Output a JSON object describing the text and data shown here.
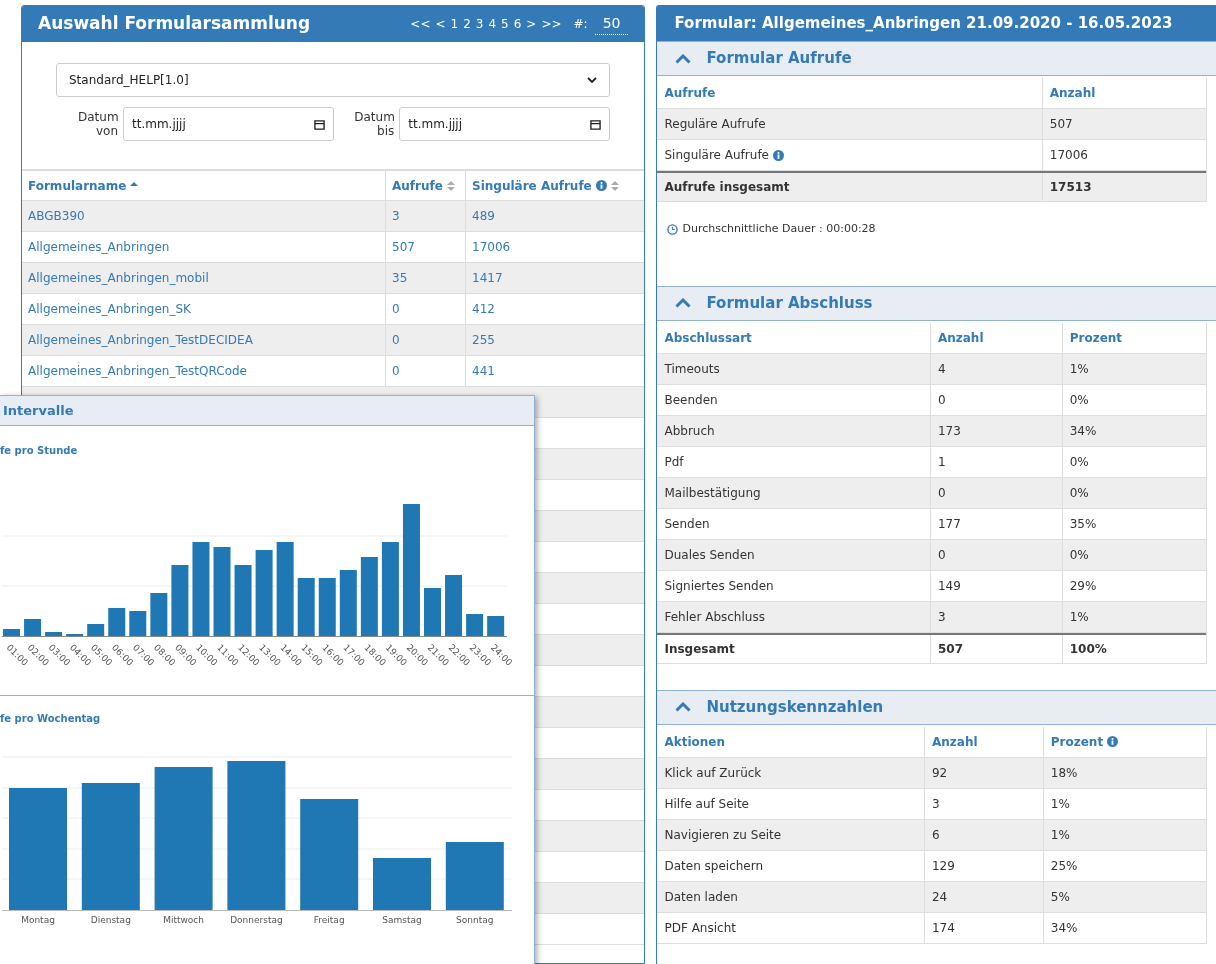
{
  "left_panel": {
    "title": "Auswahl Formularsammlung",
    "pagination": [
      "<<",
      "<",
      "1",
      "2",
      "3",
      "4",
      "5",
      "6",
      ">",
      ">>"
    ],
    "page_size_label": "#:",
    "page_size": "50",
    "collection_select": "Standard_HELP[1.0]",
    "date_fields": [
      {
        "label": "Datum von",
        "placeholder": "tt.mm.jjjj"
      },
      {
        "label": "Datum bis",
        "placeholder": "tt.mm.jjjj"
      }
    ],
    "table": {
      "columns": [
        {
          "label": "Formularname",
          "sorted": true,
          "info": false
        },
        {
          "label": "Aufrufe",
          "sorted": false,
          "info": false
        },
        {
          "label": "Singuläre Aufrufe",
          "sorted": false,
          "info": true
        }
      ],
      "rows": [
        [
          "ABGB390",
          "3",
          "489"
        ],
        [
          "Allgemeines_Anbringen",
          "507",
          "17006"
        ],
        [
          "Allgemeines_Anbringen_mobil",
          "35",
          "1417"
        ],
        [
          "Allgemeines_Anbringen_SK",
          "0",
          "412"
        ],
        [
          "Allgemeines_Anbringen_TestDECIDEA",
          "0",
          "255"
        ],
        [
          "Allgemeines_Anbringen_TestQRCode",
          "0",
          "441"
        ]
      ]
    }
  },
  "interval_popup": {
    "title": "Intervalle",
    "hourly": {
      "title": "fe pro Stunde",
      "labels": [
        "01:00",
        "02:00",
        "03:00",
        "04:00",
        "05:00",
        "06:00",
        "07:00",
        "08:00",
        "09:00",
        "10:00",
        "11:00",
        "12:00",
        "13:00",
        "14:00",
        "15:00",
        "16:00",
        "17:00",
        "18:00",
        "19:00",
        "20:00",
        "21:00",
        "22:00",
        "23:00",
        "24:00"
      ]
    },
    "weekly": {
      "title": "fe pro Wochentag",
      "labels": [
        "Montag",
        "Dienstag",
        "Mittwoch",
        "Donnerstag",
        "Freitag",
        "Samstag",
        "Sonntag"
      ]
    }
  },
  "detail_panel": {
    "title": "Formular: Allgemeines_Anbringen 21.09.2020 - 16.05.2023",
    "sections": [
      {
        "title": "Formular Aufrufe",
        "expanded": true,
        "columns": [
          {
            "label": "Aufrufe",
            "info": false
          },
          {
            "label": "Anzahl",
            "info": false
          }
        ],
        "rows": [
          {
            "cells": [
              "Reguläre Aufrufe",
              "507"
            ],
            "info": false,
            "total": false
          },
          {
            "cells": [
              "Singuläre Aufrufe",
              "17006"
            ],
            "info": true,
            "total": false
          },
          {
            "cells": [
              "Aufrufe insgesamt",
              "17513"
            ],
            "info": false,
            "total": true
          }
        ],
        "note": "Durchschnittliche Dauer : 00:00:28"
      },
      {
        "title": "Formular Abschluss",
        "expanded": true,
        "columns": [
          {
            "label": "Abschlussart",
            "info": false
          },
          {
            "label": "Anzahl",
            "info": false
          },
          {
            "label": "Prozent",
            "info": false
          }
        ],
        "rows": [
          {
            "cells": [
              "Timeouts",
              "4",
              "1%"
            ],
            "info": false,
            "total": false
          },
          {
            "cells": [
              "Beenden",
              "0",
              "0%"
            ],
            "info": false,
            "total": false
          },
          {
            "cells": [
              "Abbruch",
              "173",
              "34%"
            ],
            "info": false,
            "total": false
          },
          {
            "cells": [
              "Pdf",
              "1",
              "0%"
            ],
            "info": false,
            "total": false
          },
          {
            "cells": [
              "Mailbestätigung",
              "0",
              "0%"
            ],
            "info": false,
            "total": false
          },
          {
            "cells": [
              "Senden",
              "177",
              "35%"
            ],
            "info": false,
            "total": false
          },
          {
            "cells": [
              "Duales Senden",
              "0",
              "0%"
            ],
            "info": false,
            "total": false
          },
          {
            "cells": [
              "Signiertes Senden",
              "149",
              "29%"
            ],
            "info": false,
            "total": false
          },
          {
            "cells": [
              "Fehler Abschluss",
              "3",
              "1%"
            ],
            "info": false,
            "total": false
          },
          {
            "cells": [
              "Insgesamt",
              "507",
              "100%"
            ],
            "info": false,
            "total": true
          }
        ]
      },
      {
        "title": "Nutzungskennzahlen",
        "expanded": true,
        "columns": [
          {
            "label": "Aktionen",
            "info": false
          },
          {
            "label": "Anzahl",
            "info": false
          },
          {
            "label": "Prozent",
            "info": true
          }
        ],
        "rows": [
          {
            "cells": [
              "Klick auf Zurück",
              "92",
              "18%"
            ],
            "info": false,
            "total": false
          },
          {
            "cells": [
              "Hilfe auf Seite",
              "3",
              "1%"
            ],
            "info": false,
            "total": false
          },
          {
            "cells": [
              "Navigieren zu Seite",
              "6",
              "1%"
            ],
            "info": false,
            "total": false
          },
          {
            "cells": [
              "Daten speichern",
              "129",
              "25%"
            ],
            "info": false,
            "total": false
          },
          {
            "cells": [
              "Daten laden",
              "24",
              "5%"
            ],
            "info": false,
            "total": false
          },
          {
            "cells": [
              "PDF Ansicht",
              "174",
              "34%"
            ],
            "info": false,
            "total": false
          }
        ]
      }
    ]
  }
}
